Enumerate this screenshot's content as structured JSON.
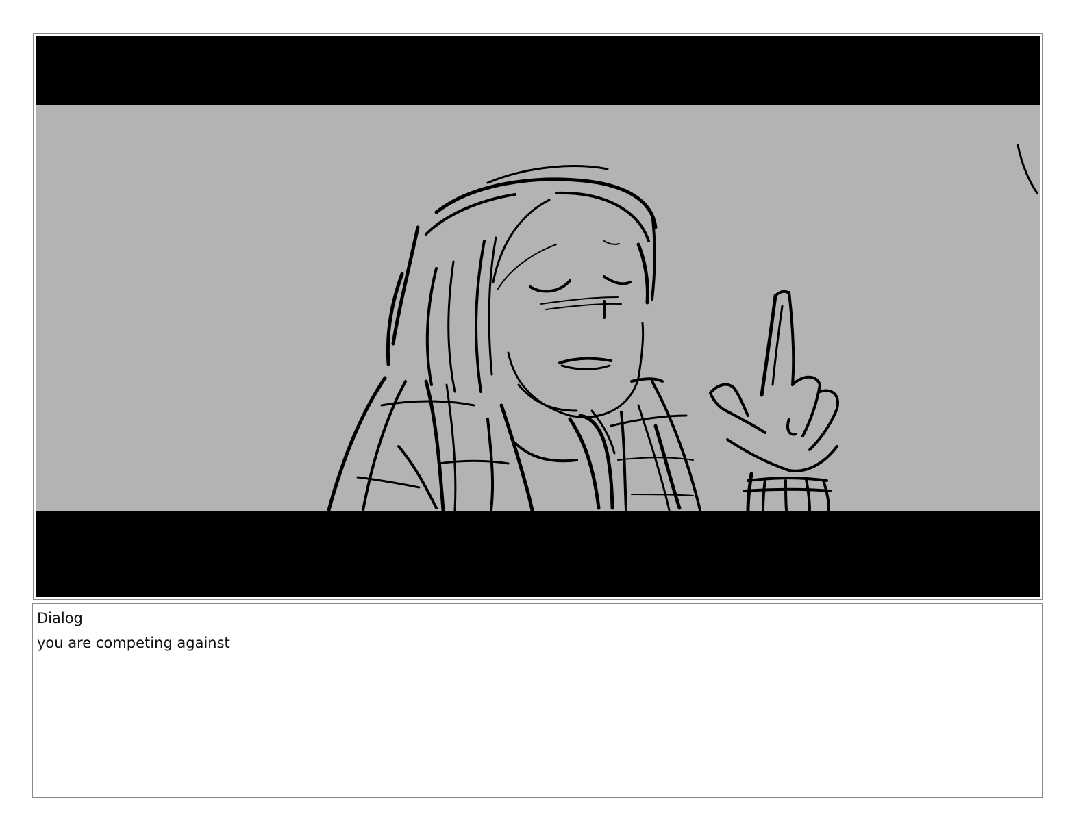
{
  "panel": {
    "image_icon": "storyboard-sketch-character-raising-finger",
    "colors": {
      "letterbox": "#000000",
      "background": "#b3b3b3",
      "ink": "#000000",
      "frame_border": "#8a8a8a"
    }
  },
  "notes": {
    "label": "Dialog",
    "text": "you are competing against"
  }
}
